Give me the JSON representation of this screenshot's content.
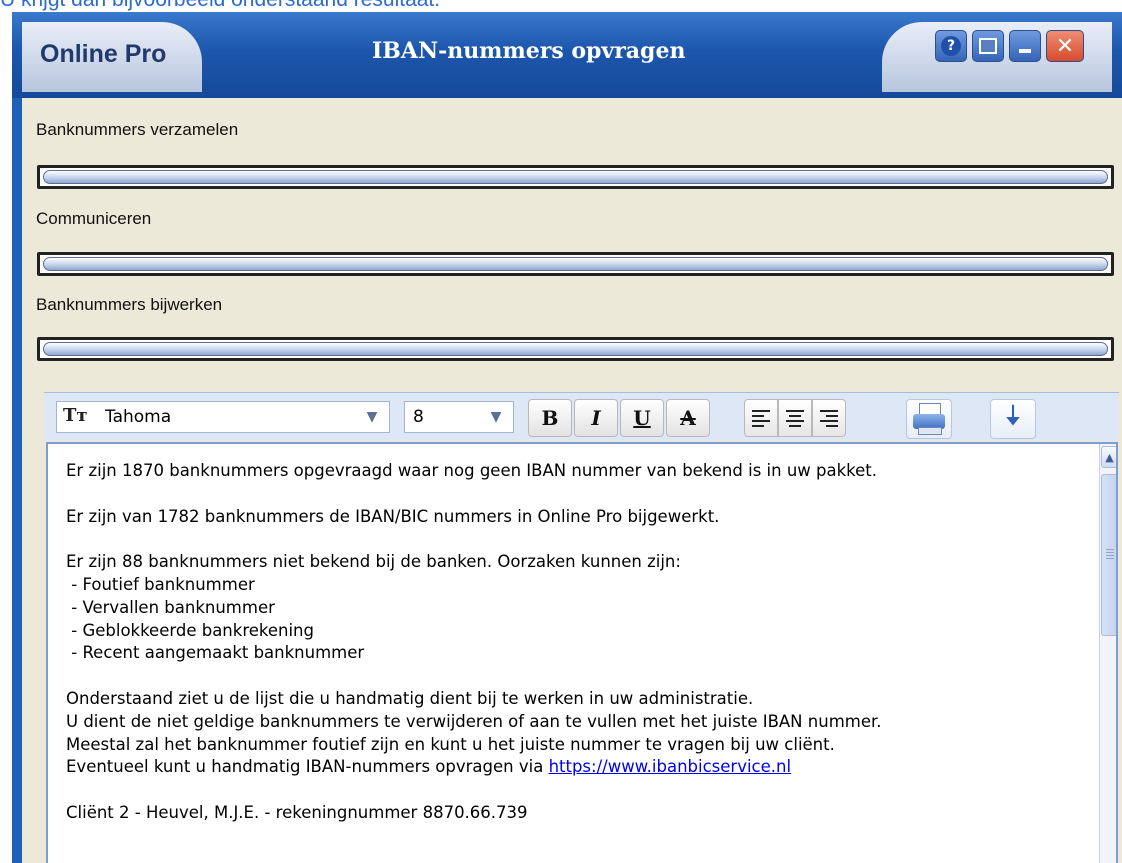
{
  "caption": "U krijgt dan bijvoorbeeld onderstaand resultaat.",
  "window": {
    "app_name": "Online Pro",
    "title": "IBAN-nummers opvragen",
    "buttons": {
      "help": "?",
      "close": "✕"
    }
  },
  "progress": [
    {
      "label": "Banknummers verzamelen",
      "value": 0
    },
    {
      "label": "Communiceren",
      "value": 0
    },
    {
      "label": "Banknummers bijwerken",
      "value": 0
    }
  ],
  "toolbar": {
    "font_icon": "Tт",
    "font_name": "Tahoma",
    "font_size": "8",
    "bold": "B",
    "italic": "I",
    "underline": "U",
    "strike": "A"
  },
  "editor": {
    "lines": [
      "Er zijn 1870 banknummers opgevraagd waar nog geen IBAN nummer van bekend is in uw pakket.",
      "",
      "Er zijn van 1782 banknummers de IBAN/BIC nummers in Online Pro bijgewerkt.",
      "",
      "Er zijn 88 banknummers niet bekend bij de banken. Oorzaken kunnen zijn:",
      " - Foutief banknummer",
      " - Vervallen banknummer",
      " - Geblokkeerde bankrekening",
      " - Recent aangemaakt banknummer",
      "",
      "Onderstaand ziet u de lijst die u handmatig dient bij te werken in uw administratie.",
      "U dient de niet geldige banknummers te verwijderen of aan te vullen met het juiste IBAN nummer.",
      "Meestal zal het banknummer foutief zijn en kunt u het juiste nummer te vragen bij uw cliënt.",
      "Eventueel kunt u handmatig IBAN-nummers opvragen via "
    ],
    "link": "https://www.ibanbicservice.nl",
    "last_line": "Cliënt 2 - Heuvel, M.J.E. - rekeningnummer 8870.66.739"
  }
}
